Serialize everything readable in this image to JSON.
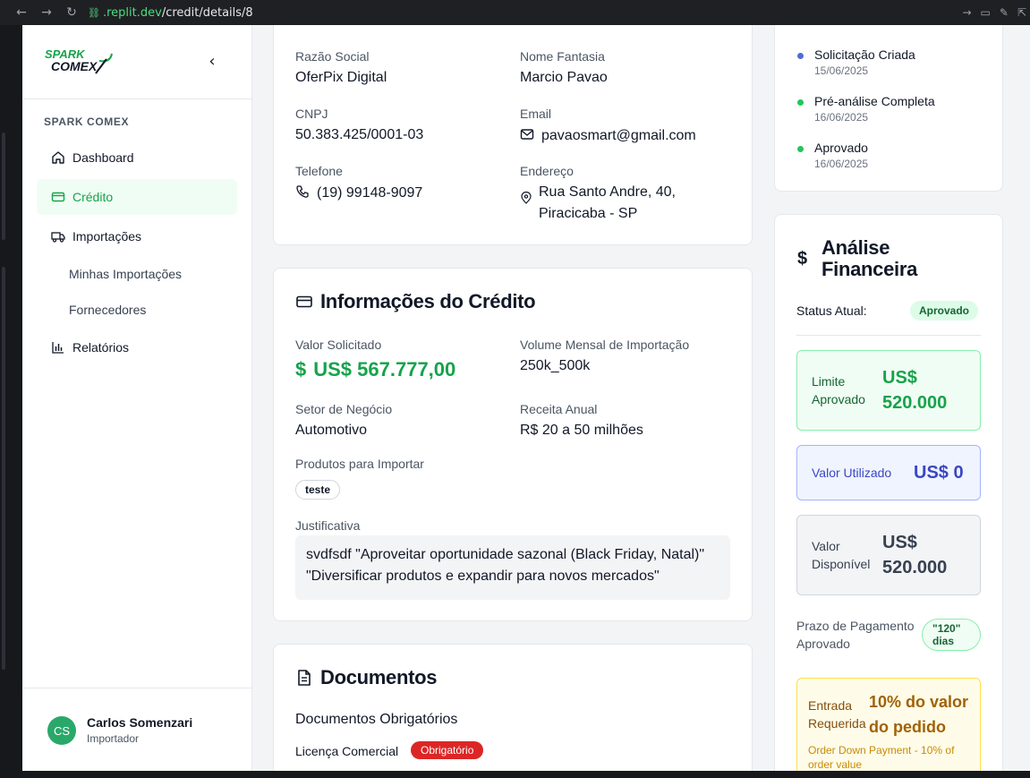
{
  "browser": {
    "url_host": ".replit.dev",
    "url_path": "/credit/details/8"
  },
  "sidebar": {
    "logo_line1": "SPARK",
    "logo_line2": "COMEX",
    "section_title": "SPARK COMEX",
    "items": [
      {
        "label": "Dashboard",
        "icon": "home-icon"
      },
      {
        "label": "Crédito",
        "icon": "credit-card-icon"
      },
      {
        "label": "Importações",
        "icon": "truck-icon"
      },
      {
        "label": "Relatórios",
        "icon": "bar-chart-icon"
      }
    ],
    "sub_items": [
      "Minhas Importações",
      "Fornecedores"
    ],
    "user": {
      "initials": "CS",
      "name": "Carlos Somenzari",
      "role": "Importador"
    }
  },
  "company": {
    "razao_label": "Razão Social",
    "razao_value": "OferPix Digital",
    "fantasia_label": "Nome Fantasia",
    "fantasia_value": "Marcio Pavao",
    "cnpj_label": "CNPJ",
    "cnpj_value": "50.383.425/0001-03",
    "email_label": "Email",
    "email_value": "pavaosmart@gmail.com",
    "telefone_label": "Telefone",
    "telefone_value": "(19) 99148-9097",
    "endereco_label": "Endereço",
    "endereco_line1": "Rua Santo Andre, 40,",
    "endereco_line2": "Piracicaba - SP"
  },
  "credit": {
    "title": "Informações do Crédito",
    "valor_label": "Valor Solicitado",
    "valor_value": "US$ 567.777,00",
    "volume_label": "Volume Mensal de Importação",
    "volume_value": "250k_500k",
    "setor_label": "Setor de Negócio",
    "setor_value": "Automotivo",
    "receita_label": "Receita Anual",
    "receita_value": "R$ 20 a 50 milhões",
    "produtos_label": "Produtos para Importar",
    "produto_tag": "teste",
    "justificativa_label": "Justificativa",
    "justificativa_line1": "svdfsdf \"Aproveitar oportunidade sazonal (Black Friday, Natal)\"",
    "justificativa_line2": "\"Diversificar produtos e expandir para novos mercados\""
  },
  "documents": {
    "title": "Documentos",
    "subtitle": "Documentos Obrigatórios",
    "item_label": "Licença Comercial",
    "item_badge": "Obrigatório"
  },
  "timeline": [
    {
      "title": "Solicitação Criada",
      "date": "15/06/2025",
      "color": "#4f6bd8"
    },
    {
      "title": "Pré-análise Completa",
      "date": "16/06/2025",
      "color": "#22c55e"
    },
    {
      "title": "Aprovado",
      "date": "16/06/2025",
      "color": "#22c55e"
    }
  ],
  "analysis": {
    "title_line1": "Análise",
    "title_line2": "Financeira",
    "status_label": "Status Atual:",
    "status_value": "Aprovado",
    "limite_label_1": "Limite",
    "limite_label_2": "Aprovado",
    "limite_value_1": "US$",
    "limite_value_2": "520.000",
    "utilizado_label": "Valor Utilizado",
    "utilizado_value": "US$ 0",
    "disponivel_label_1": "Valor",
    "disponivel_label_2": "Disponível",
    "disponivel_value_1": "US$",
    "disponivel_value_2": "520.000",
    "prazo_label_1": "Prazo de Pagamento",
    "prazo_label_2": "Aprovado",
    "prazo_value_1": "\"120\"",
    "prazo_value_2": "dias",
    "entrada_label_1": "Entrada",
    "entrada_label_2": "Requerida",
    "entrada_value_1": "10% do valor",
    "entrada_value_2": "do pedido",
    "entrada_note_1": "Order Down Payment - 10% of",
    "entrada_note_2": "order value"
  },
  "colors": {
    "accent_green": "#16a34a",
    "red": "#dc2626",
    "blue": "#3b46c4",
    "amber": "#a16207"
  }
}
